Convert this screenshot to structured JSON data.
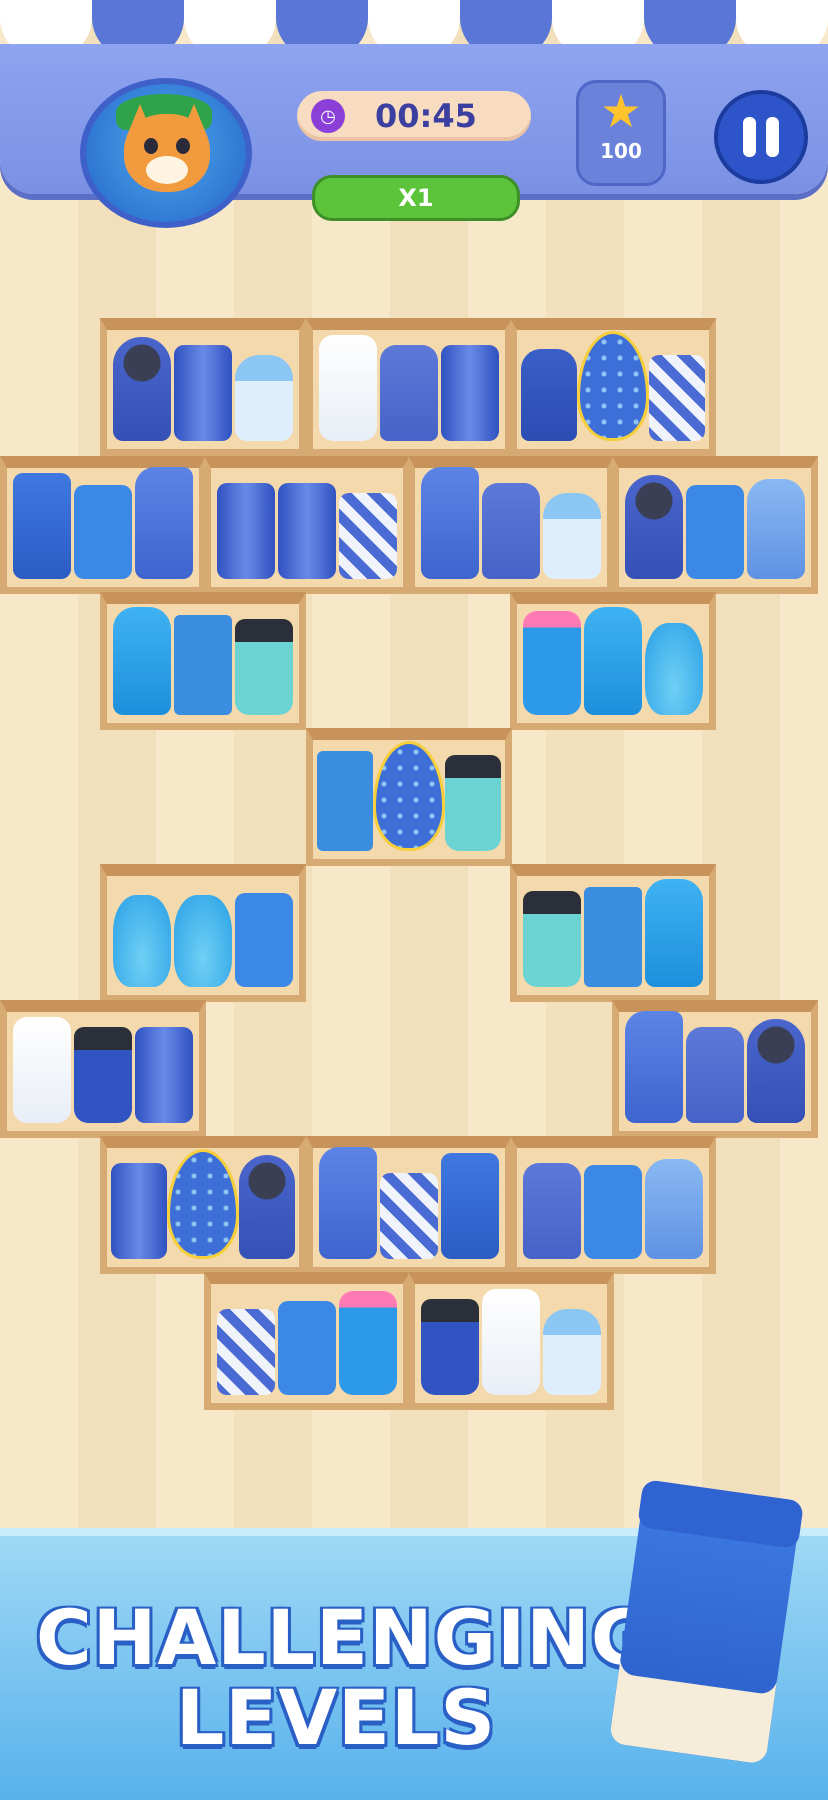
{
  "hud": {
    "timer": "00:45",
    "multiplier": "X1",
    "stars": "100"
  },
  "icons": {
    "avatar": "cat-with-green-cap",
    "timer": "clock-icon",
    "star": "star-icon",
    "pause": "pause-icon"
  },
  "shelves": [
    [
      "mic",
      "can",
      "baby"
    ],
    [
      "cream",
      "candle",
      "can"
    ],
    [
      "marker",
      "egg",
      "swirl"
    ],
    [
      "tub",
      "game",
      "spray"
    ],
    [
      "can",
      "can",
      "swirl"
    ],
    [
      "spray",
      "candle",
      "baby"
    ],
    [
      "mic",
      "game",
      "water"
    ],
    [
      "wbottle",
      "cereal",
      "cup"
    ],
    [
      "soap",
      "wbottle",
      "perfume"
    ],
    [
      "cereal",
      "egg",
      "cup"
    ],
    [
      "perfume",
      "perfume",
      "game"
    ],
    [
      "cup",
      "cereal",
      "wbottle"
    ],
    [
      "cream",
      "cup-blue",
      "can"
    ],
    [
      "spray",
      "candle",
      "mic"
    ],
    [
      "can",
      "egg",
      "mic"
    ],
    [
      "spray",
      "swirl",
      "tub"
    ],
    [
      "candle",
      "game",
      "water"
    ],
    [
      "swirl",
      "game",
      "soap"
    ],
    [
      "cup-blue",
      "cream",
      "baby"
    ]
  ],
  "banner": {
    "line1": "CHALLENGING",
    "line2": "LEVELS"
  }
}
